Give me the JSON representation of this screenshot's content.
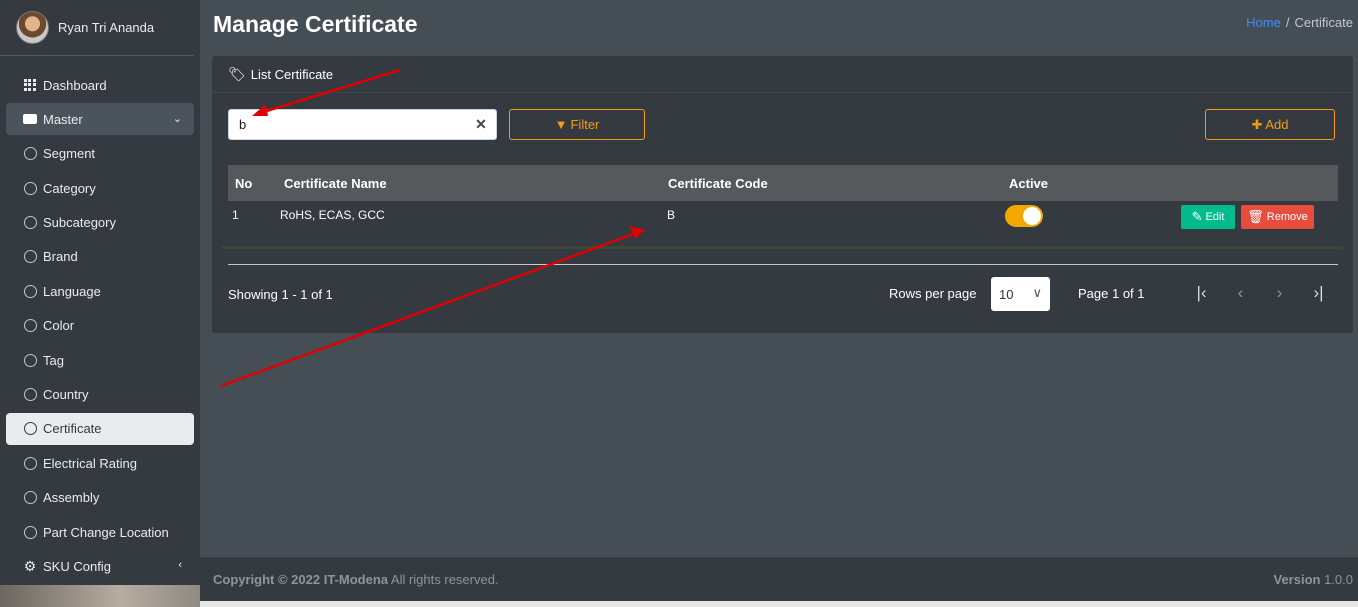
{
  "user": {
    "name": "Ryan Tri Ananda"
  },
  "sidebar": {
    "items": [
      {
        "label": "Dashboard",
        "icon": "grid-icon"
      },
      {
        "label": "Master",
        "icon": "drive-icon"
      },
      {
        "label": "Segment",
        "icon": "circle-icon"
      },
      {
        "label": "Category",
        "icon": "circle-icon"
      },
      {
        "label": "Subcategory",
        "icon": "circle-icon"
      },
      {
        "label": "Brand",
        "icon": "circle-icon"
      },
      {
        "label": "Language",
        "icon": "circle-icon"
      },
      {
        "label": "Color",
        "icon": "circle-icon"
      },
      {
        "label": "Tag",
        "icon": "circle-icon"
      },
      {
        "label": "Country",
        "icon": "circle-icon"
      },
      {
        "label": "Certificate",
        "icon": "circle-icon"
      },
      {
        "label": "Electrical Rating",
        "icon": "circle-icon"
      },
      {
        "label": "Assembly",
        "icon": "circle-icon"
      },
      {
        "label": "Part Change Location",
        "icon": "circle-icon"
      },
      {
        "label": "SKU Config",
        "icon": "gear-icon"
      }
    ]
  },
  "header": {
    "title": "Manage Certificate",
    "breadcrumb": {
      "home": "Home",
      "sep": "/",
      "current": "Certificate"
    }
  },
  "card": {
    "title": "List Certificate",
    "search_value": "b",
    "filter_label": "Filter",
    "add_label": "Add"
  },
  "table": {
    "headers": {
      "no": "No",
      "name": "Certificate Name",
      "code": "Certificate Code",
      "active": "Active"
    },
    "rows": [
      {
        "no": "1",
        "name": "RoHS, ECAS, GCC",
        "code": "B",
        "active": true,
        "edit": "Edit",
        "remove": "Remove"
      }
    ]
  },
  "pagination": {
    "showing": "Showing 1 - 1 of 1",
    "rows_label": "Rows per page",
    "rows_value": "10",
    "page_info": "Page 1 of 1"
  },
  "footer": {
    "copyright": "Copyright © 2022 IT-Modena",
    "rights": "All rights reserved.",
    "version_label": "Version",
    "version_value": "1.0.0"
  },
  "colors": {
    "accent": "#f39c12",
    "edit": "#00bc8c",
    "remove": "#e74c3c",
    "toggle": "#f3a800",
    "arrow": "#e00000"
  }
}
